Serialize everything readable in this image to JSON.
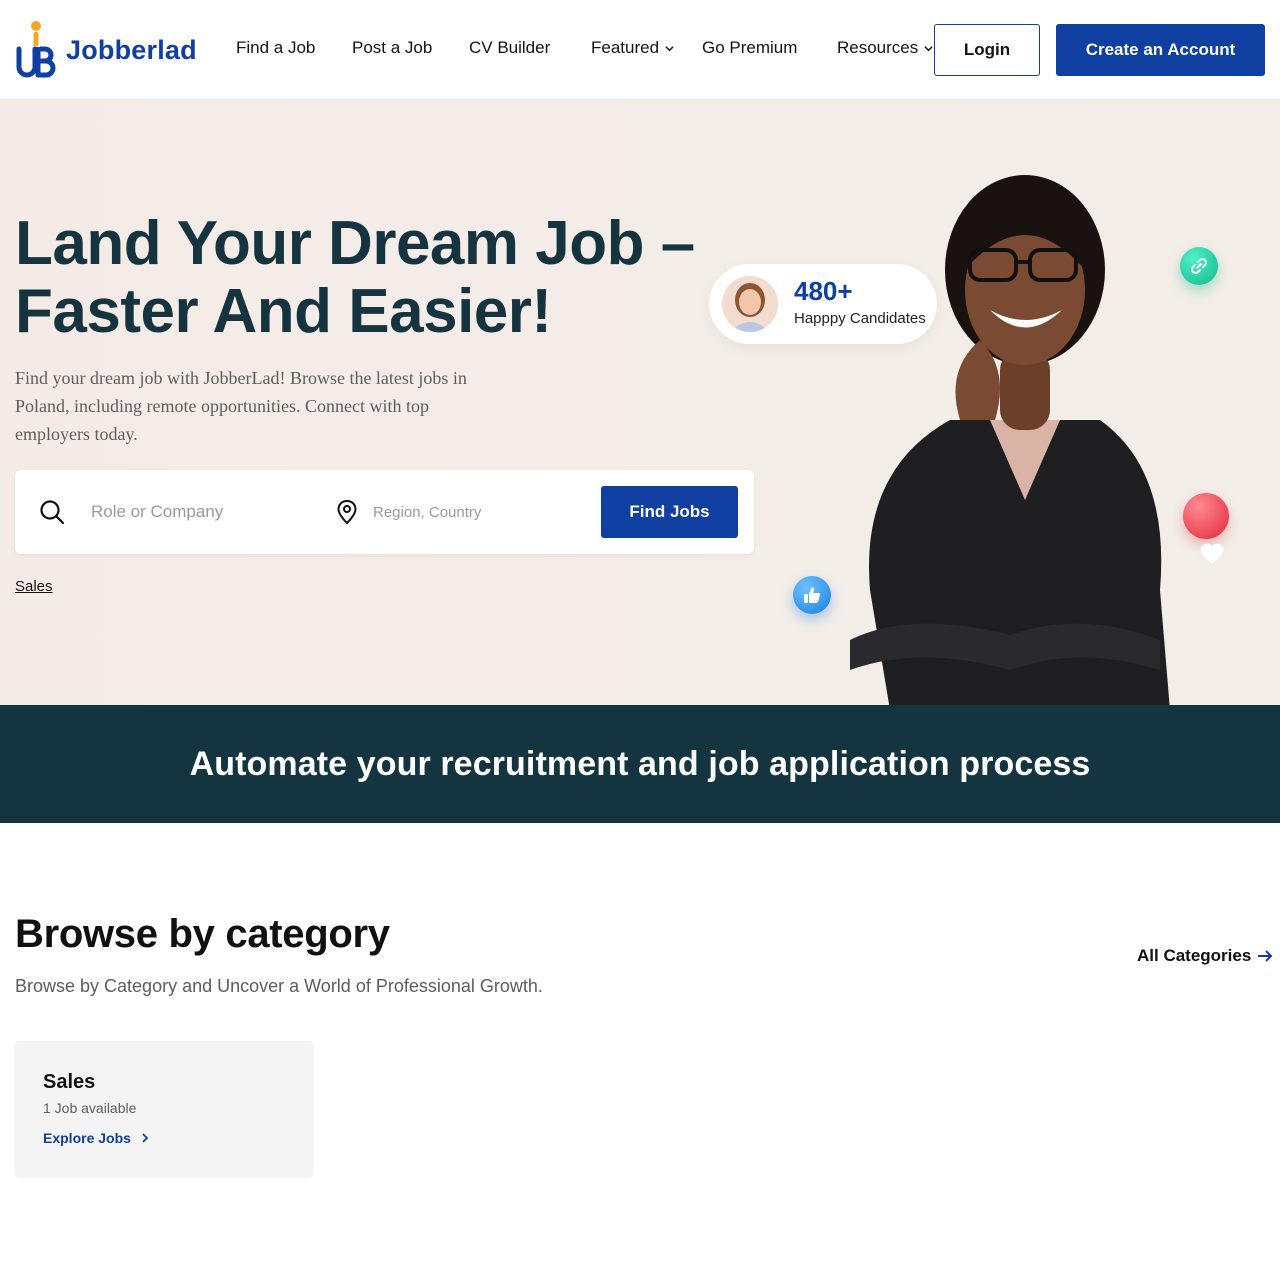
{
  "brand": {
    "name": "Jobberlad",
    "accent": "#0f3fa0",
    "logo_dot": "#f5a623"
  },
  "nav": {
    "items": [
      {
        "label": "Find a Job",
        "dropdown": false
      },
      {
        "label": "Post a Job",
        "dropdown": false
      },
      {
        "label": "CV Builder",
        "dropdown": false
      },
      {
        "label": "Featured",
        "dropdown": true
      },
      {
        "label": "Go Premium",
        "dropdown": false
      },
      {
        "label": "Resources",
        "dropdown": true
      }
    ],
    "login_label": "Login",
    "create_label": "Create an Account"
  },
  "hero": {
    "title_line1": "Land Your Dream Job –",
    "title_line2": "Faster And Easier!",
    "description": "Find your dream job with JobberLad! Browse the latest jobs in Poland, including remote opportunities. Connect with top employers today.",
    "background": "#f4ebe7",
    "title_color": "#153440"
  },
  "search": {
    "role_placeholder": "Role or Company",
    "region_placeholder": "Region, Country",
    "button_label": "Find Jobs",
    "popular_tag": "Sales"
  },
  "stats": {
    "number": "480+",
    "label": "Happpy Candidates"
  },
  "floating_icons": [
    "link-icon",
    "heart-icon",
    "thumbs-up-icon"
  ],
  "banner": {
    "text": "Automate your recruitment and job application process",
    "background": "#143440"
  },
  "categories": {
    "title": "Browse by category",
    "subtitle": "Browse by Category and Uncover a World of Professional Growth.",
    "all_label": "All Categories",
    "items": [
      {
        "name": "Sales",
        "count": "1 Job available",
        "link": "Explore Jobs"
      }
    ]
  }
}
